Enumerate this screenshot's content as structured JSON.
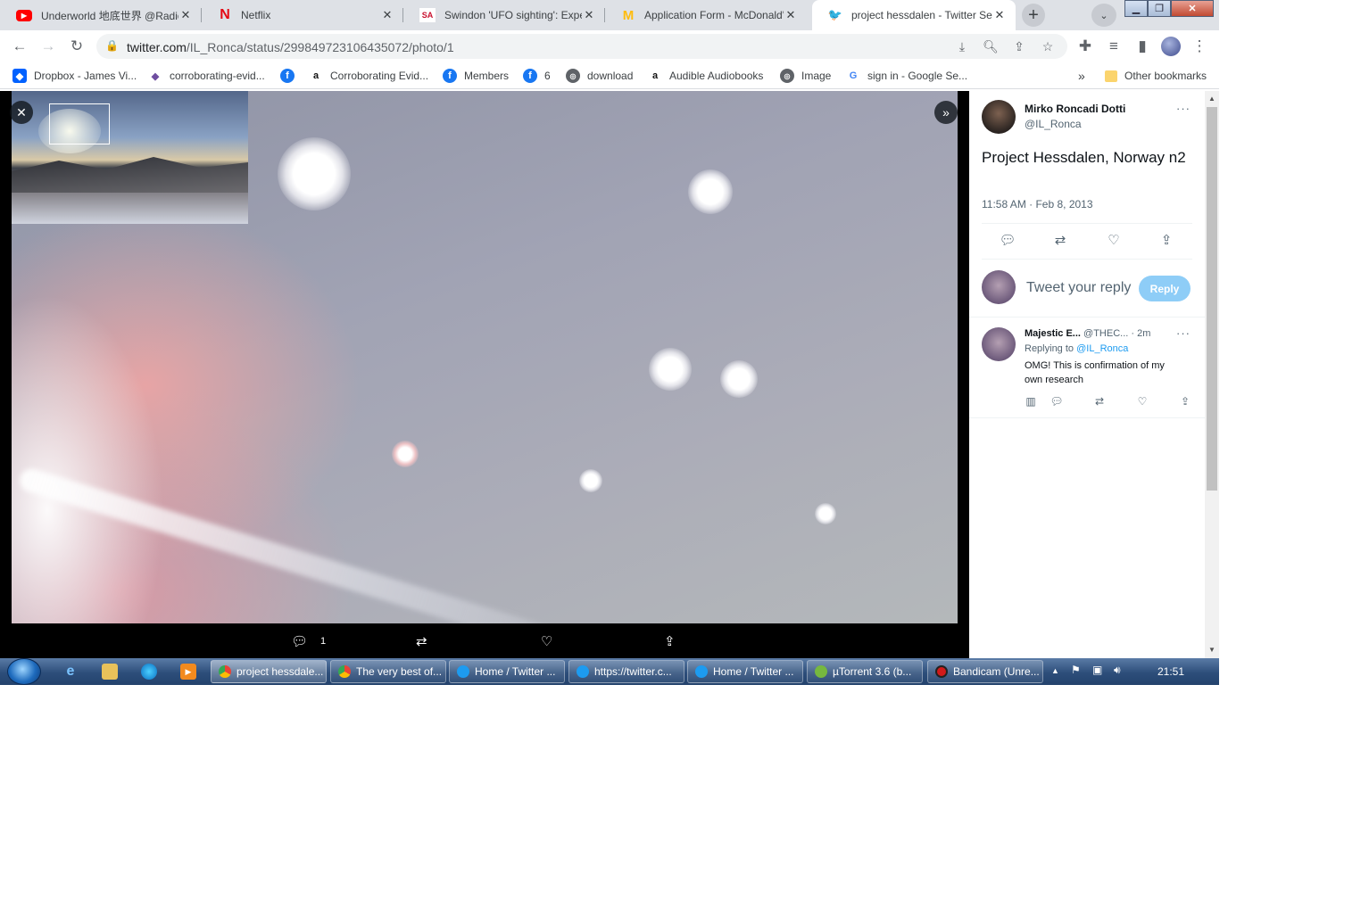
{
  "tabs": [
    {
      "title": "Underworld 地底世界 @Radio",
      "favicon": "youtube-icon",
      "color": "#ff0000",
      "glyph": "▶"
    },
    {
      "title": "Netflix",
      "favicon": "netflix-icon",
      "color": "#e50914",
      "glyph": "N"
    },
    {
      "title": "Swindon 'UFO sighting': Expert",
      "favicon": "sa-icon",
      "color": "#c8102e",
      "glyph": "SA"
    },
    {
      "title": "Application Form - McDonald's",
      "favicon": "mcdonalds-icon",
      "color": "#ffbc0d",
      "glyph": "M"
    },
    {
      "title": "project hessdalen - Twitter Sea",
      "favicon": "twitter-icon",
      "color": "#1d9bf0",
      "glyph": "🐦"
    }
  ],
  "address": {
    "domain": "twitter.com",
    "path": "/IL_Ronca/status/299849723106435072/photo/1"
  },
  "bookmarks": [
    {
      "label": "Dropbox - James Vi...",
      "icon": "dropbox-icon",
      "glyph": "◆",
      "color": "#0061ff"
    },
    {
      "label": "corroborating-evid...",
      "icon": "obsidian-icon",
      "glyph": "◆",
      "color": "#6f4ea0"
    },
    {
      "label": "",
      "icon": "facebook-icon",
      "glyph": "f",
      "color": "#1877f2"
    },
    {
      "label": "Corroborating Evid...",
      "icon": "amazon-icon",
      "glyph": "a",
      "color": "#111111"
    },
    {
      "label": "Members",
      "icon": "facebook-icon",
      "glyph": "f",
      "color": "#1877f2"
    },
    {
      "label": "6",
      "icon": "facebook-icon",
      "glyph": "f",
      "color": "#1877f2"
    },
    {
      "label": "download",
      "icon": "globe-icon",
      "glyph": "●",
      "color": "#5f6368"
    },
    {
      "label": "Audible Audiobooks",
      "icon": "amazon-icon",
      "glyph": "a",
      "color": "#111111"
    },
    {
      "label": "Image",
      "icon": "globe-icon",
      "glyph": "●",
      "color": "#5f6368"
    },
    {
      "label": "sign in - Google Se...",
      "icon": "google-icon",
      "glyph": "G",
      "color": "#4285f4"
    }
  ],
  "bookmarks_more": "»",
  "other_bookmarks": "Other bookmarks",
  "photo": {
    "reply_count": "1"
  },
  "tweet": {
    "author": "Mirko Roncadi Dotti",
    "handle": "@IL_Ronca",
    "text": "Project Hessdalen, Norway n2",
    "time": "11:58 AM · Feb 8, 2013",
    "reply_placeholder": "Tweet your reply",
    "reply_button": "Reply"
  },
  "reply": {
    "name": "Majestic E...",
    "handle": "@THEC...",
    "age": "· 2m",
    "replying_prefix": "Replying to",
    "replying_to": "@IL_Ronca",
    "text": "OMG! This is confirmation of my own research"
  },
  "taskbar": {
    "items": [
      {
        "label": "project hessdale...",
        "color": "#f4b400"
      },
      {
        "label": "The very best of...",
        "color": "#f4b400"
      },
      {
        "label": "Home / Twitter ...",
        "color": "#1d9bf0"
      },
      {
        "label": "https://twitter.c...",
        "color": "#1d9bf0"
      },
      {
        "label": "Home / Twitter ...",
        "color": "#1d9bf0"
      },
      {
        "label": "µTorrent 3.6  (b...",
        "color": "#76b83f"
      },
      {
        "label": "Bandicam (Unre...",
        "color": "#d11a1a"
      }
    ],
    "clock": "21:51"
  }
}
